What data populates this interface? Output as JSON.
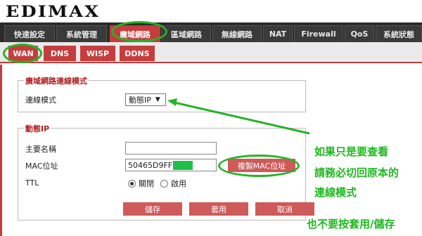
{
  "brand": {
    "logo_text": "EDIMAX"
  },
  "main_tabs": [
    {
      "label": "快速設定",
      "active": false
    },
    {
      "label": "系統管理",
      "active": false
    },
    {
      "label": "廣域網路",
      "active": true
    },
    {
      "label": "區域網路",
      "active": false
    },
    {
      "label": "無線網路",
      "active": false
    },
    {
      "label": "NAT",
      "active": false
    },
    {
      "label": "Firewall",
      "active": false
    },
    {
      "label": "QoS",
      "active": false
    },
    {
      "label": "系統狀態",
      "active": false
    }
  ],
  "sub_tabs": [
    {
      "label": "WAN",
      "active": true
    },
    {
      "label": "DNS",
      "active": false
    },
    {
      "label": "WISP",
      "active": false
    },
    {
      "label": "DDNS",
      "active": false
    }
  ],
  "connection_section": {
    "legend": "廣域網路連線模式",
    "mode_label": "連線模式",
    "mode_value": "動態IP",
    "mode_arrow": "▼"
  },
  "dynamic_ip_section": {
    "legend": "動態IP",
    "hostname_label": "主要名稱",
    "hostname_value": "",
    "mac_label": "MAC位址",
    "mac_value": "50465D9FF",
    "clone_mac_button": "複製MAC位址",
    "ttl_label": "TTL",
    "ttl_options": [
      "關閉",
      "啟用"
    ],
    "ttl_selected": "關閉"
  },
  "actions": {
    "save": "儲存",
    "apply": "套用",
    "cancel": "取消"
  },
  "annotations": {
    "line1": "如果只是要查看",
    "line2": "請務必切回原本的",
    "line3": "連線模式",
    "line4": "也不要按套用/儲存"
  },
  "colors": {
    "accent": "#c53d3d",
    "annotation": "#1db81d",
    "legend_text": "#b01e1e",
    "mac_mask": "#1fc04a"
  }
}
